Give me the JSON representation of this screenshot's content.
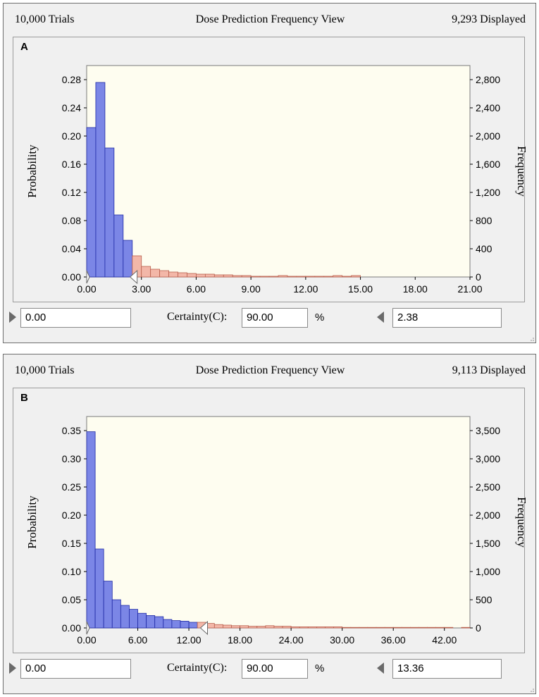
{
  "panels": [
    {
      "id": "a",
      "letter": "A",
      "trials": "10,000 Trials",
      "title": "Dose Prediction Frequency View",
      "displayed": "9,293 Displayed",
      "left_value": "0.00",
      "certainty_label": "Certainty(C):",
      "certainty_value": "90.00",
      "percent_sign": "%",
      "right_value": "2.38"
    },
    {
      "id": "b",
      "letter": "B",
      "trials": "10,000 Trials",
      "title": "Dose Prediction Frequency View",
      "displayed": "9,113 Displayed",
      "left_value": "0.00",
      "certainty_label": "Certainty(C):",
      "certainty_value": "90.00",
      "percent_sign": "%",
      "right_value": "13.36"
    }
  ],
  "colors": {
    "in_range_bar": "#7b86e6",
    "in_range_edge": "#1f2aa6",
    "out_range_bar": "#f3b7a8",
    "out_range_edge": "#b8604e",
    "plot_bg": "#fefdf0"
  },
  "chart_data": [
    {
      "type": "bar",
      "panel": "A",
      "xlabel": "",
      "ylabel": "Probability",
      "y2label": "Frequency",
      "x_ticks": [
        "0.00",
        "3.00",
        "6.00",
        "9.00",
        "12.00",
        "15.00",
        "18.00",
        "21.00"
      ],
      "x_range": [
        0,
        21
      ],
      "y_ticks": [
        "0.00",
        "0.04",
        "0.08",
        "0.12",
        "0.16",
        "0.20",
        "0.24",
        "0.28"
      ],
      "y_range": [
        0,
        0.3
      ],
      "y2_ticks": [
        "0",
        "400",
        "800",
        "1,200",
        "1,600",
        "2,000",
        "2,400",
        "2,800"
      ],
      "certainty_cutoff": 2.38,
      "bin_width": 0.5,
      "bin_starts": [
        0,
        0.5,
        1,
        1.5,
        2,
        2.5,
        3,
        3.5,
        4,
        4.5,
        5,
        5.5,
        6,
        6.5,
        7,
        7.5,
        8,
        8.5,
        9,
        9.5,
        10,
        10.5,
        11,
        11.5,
        12,
        12.5,
        13,
        13.5,
        14,
        14.5
      ],
      "values": [
        0.212,
        0.276,
        0.183,
        0.088,
        0.052,
        0.03,
        0.015,
        0.011,
        0.009,
        0.007,
        0.006,
        0.005,
        0.004,
        0.004,
        0.003,
        0.003,
        0.002,
        0.002,
        0.001,
        0.001,
        0.001,
        0.002,
        0.001,
        0.001,
        0.001,
        0.001,
        0.001,
        0.002,
        0.001,
        0.002
      ]
    },
    {
      "type": "bar",
      "panel": "B",
      "xlabel": "",
      "ylabel": "Probability",
      "y2label": "Frequency",
      "x_ticks": [
        "0.00",
        "6.00",
        "12.00",
        "18.00",
        "24.00",
        "30.00",
        "36.00",
        "42.00"
      ],
      "x_range": [
        0,
        45
      ],
      "y_ticks": [
        "0.00",
        "0.05",
        "0.10",
        "0.15",
        "0.20",
        "0.25",
        "0.30",
        "0.35"
      ],
      "y_range": [
        0,
        0.375
      ],
      "y2_ticks": [
        "0",
        "500",
        "1,000",
        "1,500",
        "2,000",
        "2,500",
        "3,000",
        "3,500"
      ],
      "certainty_cutoff": 13.36,
      "bin_width": 1,
      "bin_starts": [
        0,
        1,
        2,
        3,
        4,
        5,
        6,
        7,
        8,
        9,
        10,
        11,
        12,
        13,
        14,
        15,
        16,
        17,
        18,
        19,
        20,
        21,
        22,
        23,
        24,
        25,
        26,
        27,
        28,
        29,
        30,
        31,
        32,
        33,
        34,
        35,
        36,
        37,
        38,
        39,
        40,
        41,
        42,
        43,
        44
      ],
      "values": [
        0.348,
        0.14,
        0.083,
        0.05,
        0.04,
        0.033,
        0.026,
        0.022,
        0.02,
        0.015,
        0.013,
        0.012,
        0.01,
        0.01,
        0.008,
        0.006,
        0.005,
        0.004,
        0.004,
        0.003,
        0.003,
        0.004,
        0.003,
        0.003,
        0.002,
        0.002,
        0.002,
        0.002,
        0.002,
        0.002,
        0.001,
        0.001,
        0.001,
        0.001,
        0.001,
        0.001,
        0.001,
        0.001,
        0.001,
        0.001,
        0.001,
        0.001,
        0.001,
        0.0,
        0.001
      ]
    }
  ]
}
